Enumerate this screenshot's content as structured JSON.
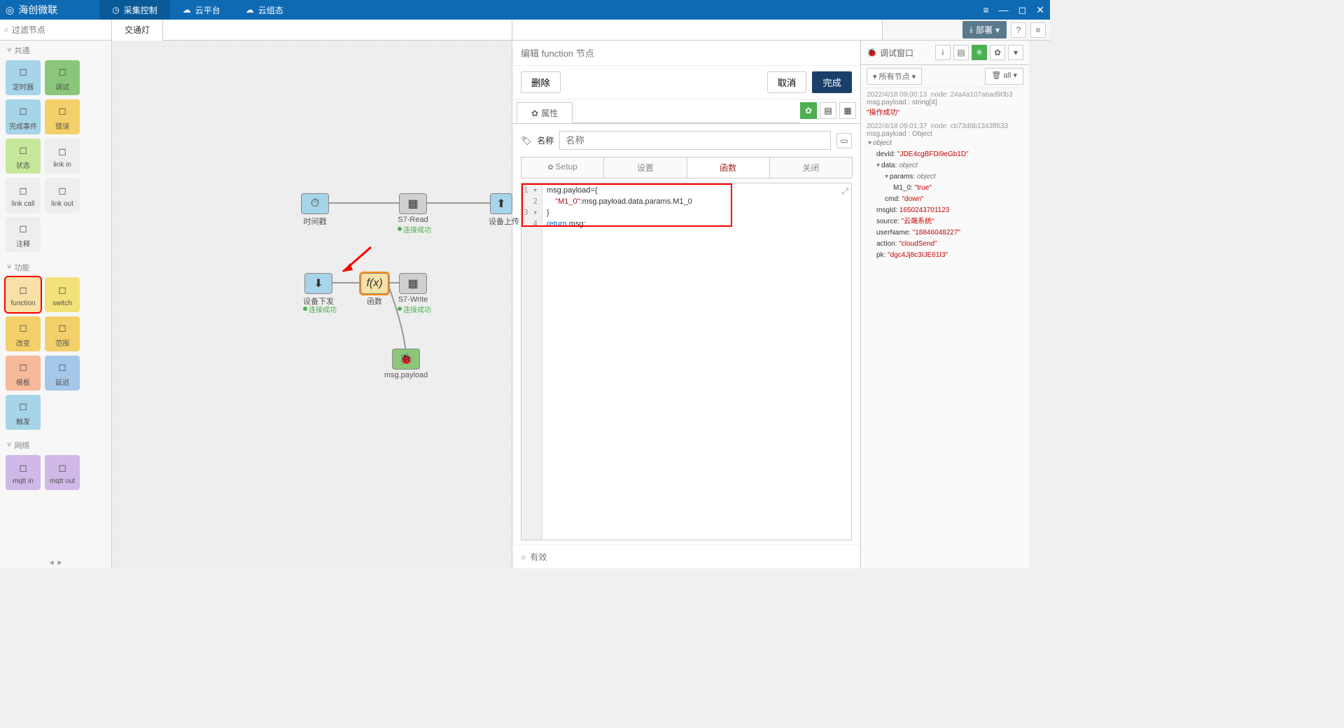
{
  "brand": "海创微联",
  "main_tabs": [
    "采集控制",
    "云平台",
    "云组态"
  ],
  "filter_placeholder": "过滤节点",
  "flow_tab": "交通灯",
  "deploy": "部署",
  "palette": {
    "cat_common": "共通",
    "cat_func": "功能",
    "cat_net": "网络",
    "common": [
      {
        "label": "定时器",
        "color": "#a6d4e8"
      },
      {
        "label": "调试",
        "color": "#8bc77a"
      },
      {
        "label": "完成事件",
        "color": "#a6d4e8"
      },
      {
        "label": "错误",
        "color": "#f3d06a"
      },
      {
        "label": "状态",
        "color": "#c7e89a"
      },
      {
        "label": "link in",
        "color": "#eee"
      },
      {
        "label": "link call",
        "color": "#eee"
      },
      {
        "label": "link out",
        "color": "#eee"
      },
      {
        "label": "注释",
        "color": "#eee"
      }
    ],
    "func": [
      {
        "label": "function",
        "color": "#f8e0a6",
        "hl": true
      },
      {
        "label": "switch",
        "color": "#f3e27a"
      },
      {
        "label": "改变",
        "color": "#f3d06a"
      },
      {
        "label": "范围",
        "color": "#f3d06a"
      },
      {
        "label": "模板",
        "color": "#f8b89a"
      },
      {
        "label": "延迟",
        "color": "#a6c8e8"
      },
      {
        "label": "触发",
        "color": "#a6d4e8"
      }
    ],
    "net": [
      {
        "label": "mqtt in",
        "color": "#d0b8e8"
      },
      {
        "label": "mqtt out",
        "color": "#d0b8e8"
      }
    ]
  },
  "canvas_nodes": {
    "timer": "时间戳",
    "s7read": "S7-Read",
    "s7read_status": "连接成功",
    "devup": "设备上传",
    "devdown": "设备下发",
    "devdown_status": "连接成功",
    "fx": "函数",
    "s7write": "S7-Write",
    "s7write_status": "连接成功",
    "debug": "msg.payload"
  },
  "editor": {
    "title": "编辑 function 节点",
    "delete": "删除",
    "cancel": "取消",
    "done": "完成",
    "tab_props": "属性",
    "name_label": "名称",
    "name_placeholder": "名称",
    "code_tabs": [
      "Setup",
      "设置",
      "函数",
      "关闭"
    ],
    "code_lines": [
      "msg.payload={",
      "    \"M1_0\":msg.payload.data.params.M1_0",
      "}",
      "return msg;"
    ],
    "footer_valid": "有效"
  },
  "debug": {
    "title": "调试窗口",
    "filter_all_nodes": "所有节点",
    "filter_all": "all",
    "log1": {
      "ts": "2022/4/18 09:00:13",
      "node": "node: 24a4a107abad90b3",
      "path": "msg.payload : string[4]",
      "value": "\"操作成功\""
    },
    "log2": {
      "ts": "2022/4/18 09:01:37",
      "node": "node: cb73d6b1343ff633",
      "path": "msg.payload : Object",
      "tree": {
        "devId": "\"JDE4cgBFDi9eGb1D\"",
        "data_params_M1_0": "\"true\"",
        "data_cmd": "\"down\"",
        "msgId": "1650243701123",
        "source": "\"云端系统\"",
        "userName": "\"18846048227\"",
        "action": "\"cloudSend\"",
        "pk": "\"dgc4Jj8c3IJE61I3\""
      }
    }
  }
}
